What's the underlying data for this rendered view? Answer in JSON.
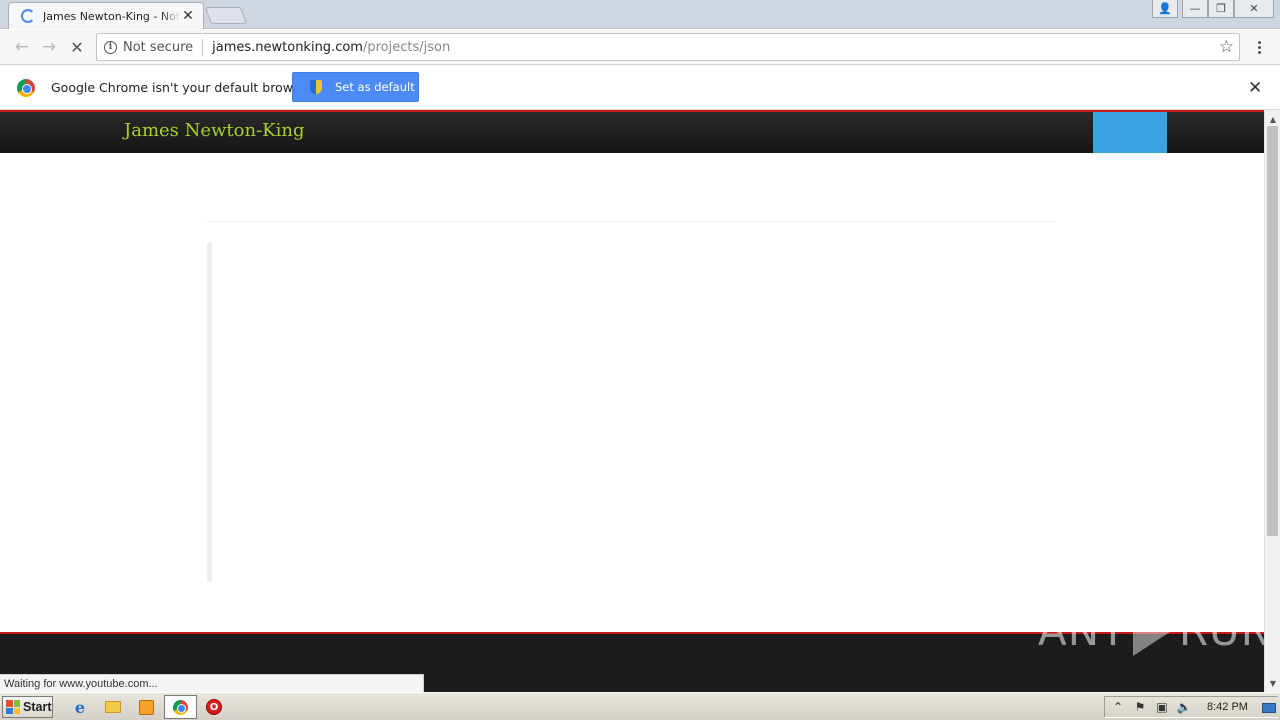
{
  "browser": {
    "tab": {
      "title": "James Newton-King - Not fo",
      "close_glyph": "✕"
    },
    "window_controls": {
      "user": "👤",
      "minimize": "—",
      "maximize": "❐",
      "close": "✕"
    },
    "toolbar": {
      "back_glyph": "←",
      "forward_glyph": "→",
      "stop_glyph": "✕",
      "security_label": "Not secure",
      "url_host": "james.newtonking.com",
      "url_path": "/projects/json",
      "star_glyph": "☆"
    },
    "infobar": {
      "message": "Google Chrome isn't your default browser",
      "button_label": "Set as default",
      "close_glyph": "✕"
    },
    "status": "Waiting for www.youtube.com..."
  },
  "site": {
    "title": "James Newton-King",
    "accent_title": "#a8cf2c",
    "header_block_color": "#3aa3e3",
    "border_red": "#c41a1a"
  },
  "watermark": {
    "left": "ANY",
    "right": "RUN"
  },
  "scrollbar": {
    "up": "▲",
    "down": "▼"
  },
  "taskbar": {
    "start_label": "Start",
    "ie_glyph": "e",
    "opera_glyph": "O",
    "tray": {
      "expand": "⌃",
      "flag": "⚑",
      "network": "▣",
      "volume": "🔈",
      "clock": "8:42 PM"
    }
  },
  "icons": [
    "chrome-logo-icon",
    "shield-icon",
    "info-icon",
    "star-icon",
    "menu-icon",
    "ie-icon",
    "folder-icon",
    "media-player-icon",
    "chrome-icon",
    "opera-icon"
  ]
}
